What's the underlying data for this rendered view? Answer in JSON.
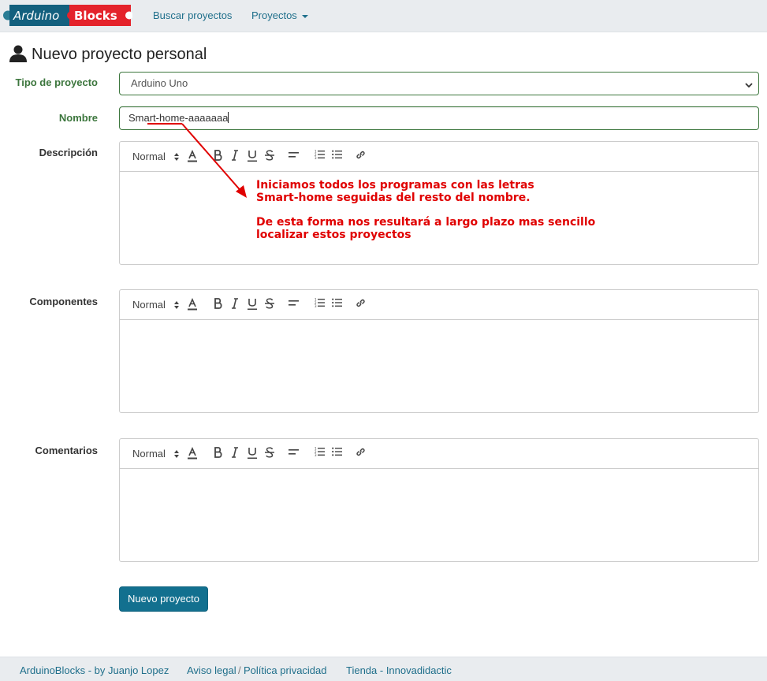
{
  "navbar": {
    "logo_text_left": "Arduino",
    "logo_text_right": "Blocks",
    "links": {
      "search": "Buscar proyectos",
      "projects": "Proyectos"
    }
  },
  "page": {
    "title": "Nuevo proyecto personal"
  },
  "form": {
    "type_label": "Tipo de proyecto",
    "type_value": "Arduino Uno",
    "name_label": "Nombre",
    "name_value": "Smart-home-aaaaaaa",
    "description_label": "Descripción",
    "components_label": "Componentes",
    "comments_label": "Comentarios",
    "editor_format": "Normal",
    "submit_label": "Nuevo proyecto"
  },
  "annotation": {
    "line1": "Iniciamos todos los programas con las letras",
    "line2": "Smart-home seguidas del resto del nombre.",
    "line3": "De esta forma nos resultará a largo plazo mas sencillo",
    "line4": "localizar estos proyectos",
    "color": "#e00000"
  },
  "footer": {
    "author": "ArduinoBlocks - by Juanjo Lopez",
    "legal": "Aviso legal",
    "separator": "/",
    "privacy": "Política privacidad",
    "store": "Tienda - Innovadidactic"
  },
  "colors": {
    "accent": "#12708f",
    "link": "#1f6f8b",
    "success": "#3c763d",
    "navbar_bg": "#e9ecef"
  }
}
